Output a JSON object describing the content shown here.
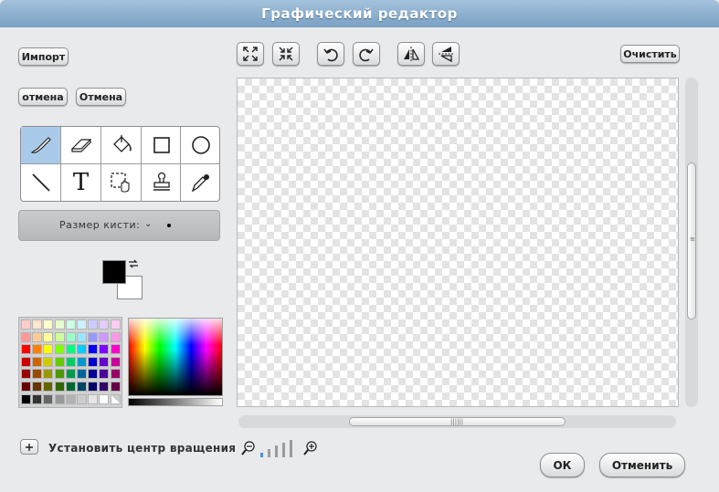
{
  "window": {
    "title": "Графический редактор"
  },
  "left_buttons": {
    "import": "Импорт",
    "undo": "отмена",
    "redo": "Отмена"
  },
  "toolbar": {
    "icons": [
      "expand-icon",
      "shrink-icon",
      "rotate-left-icon",
      "rotate-right-icon",
      "flip-horizontal-icon",
      "flip-vertical-icon"
    ],
    "clear": "Очистить"
  },
  "tools": {
    "items": [
      "brush",
      "eraser",
      "fill",
      "rectangle",
      "ellipse",
      "line",
      "text",
      "select",
      "stamp",
      "eyedropper"
    ],
    "selected": "brush",
    "text_glyph": "T"
  },
  "brush": {
    "label": "Размер кисти:",
    "arrow": "⌄"
  },
  "colors": {
    "foreground": "#000000",
    "background": "#ffffff",
    "palette": [
      [
        "#ffcccc",
        "#ffe5cc",
        "#ffffcc",
        "#e5ffcc",
        "#ccffe5",
        "#ccf2ff",
        "#ccccff",
        "#e5ccff",
        "#ffccf2"
      ],
      [
        "#ff9999",
        "#ffcc99",
        "#ffff99",
        "#ccff99",
        "#99ffcc",
        "#99e5ff",
        "#9999ff",
        "#cc99ff",
        "#ff99e5"
      ],
      [
        "#ff0000",
        "#ff8000",
        "#ffff00",
        "#80ff00",
        "#00ff80",
        "#00ccff",
        "#0000ff",
        "#8000ff",
        "#ff00cc"
      ],
      [
        "#cc0000",
        "#cc6600",
        "#cccc00",
        "#66cc00",
        "#00cc66",
        "#0099cc",
        "#0000cc",
        "#6600cc",
        "#cc0099"
      ],
      [
        "#990000",
        "#994c00",
        "#999900",
        "#4c9900",
        "#00994c",
        "#006699",
        "#000099",
        "#4c0099",
        "#990066"
      ],
      [
        "#660000",
        "#663300",
        "#666600",
        "#336600",
        "#006633",
        "#004466",
        "#000066",
        "#330066",
        "#660044"
      ],
      [
        "#000000",
        "#333333",
        "#666666",
        "#999999",
        "#b3b3b3",
        "#cccccc",
        "#e6e6e6",
        "#ffffff",
        "transparent"
      ]
    ]
  },
  "rotation": {
    "label": "Установить центр вращения"
  },
  "footer": {
    "ok": "ОК",
    "cancel": "Отменить"
  }
}
